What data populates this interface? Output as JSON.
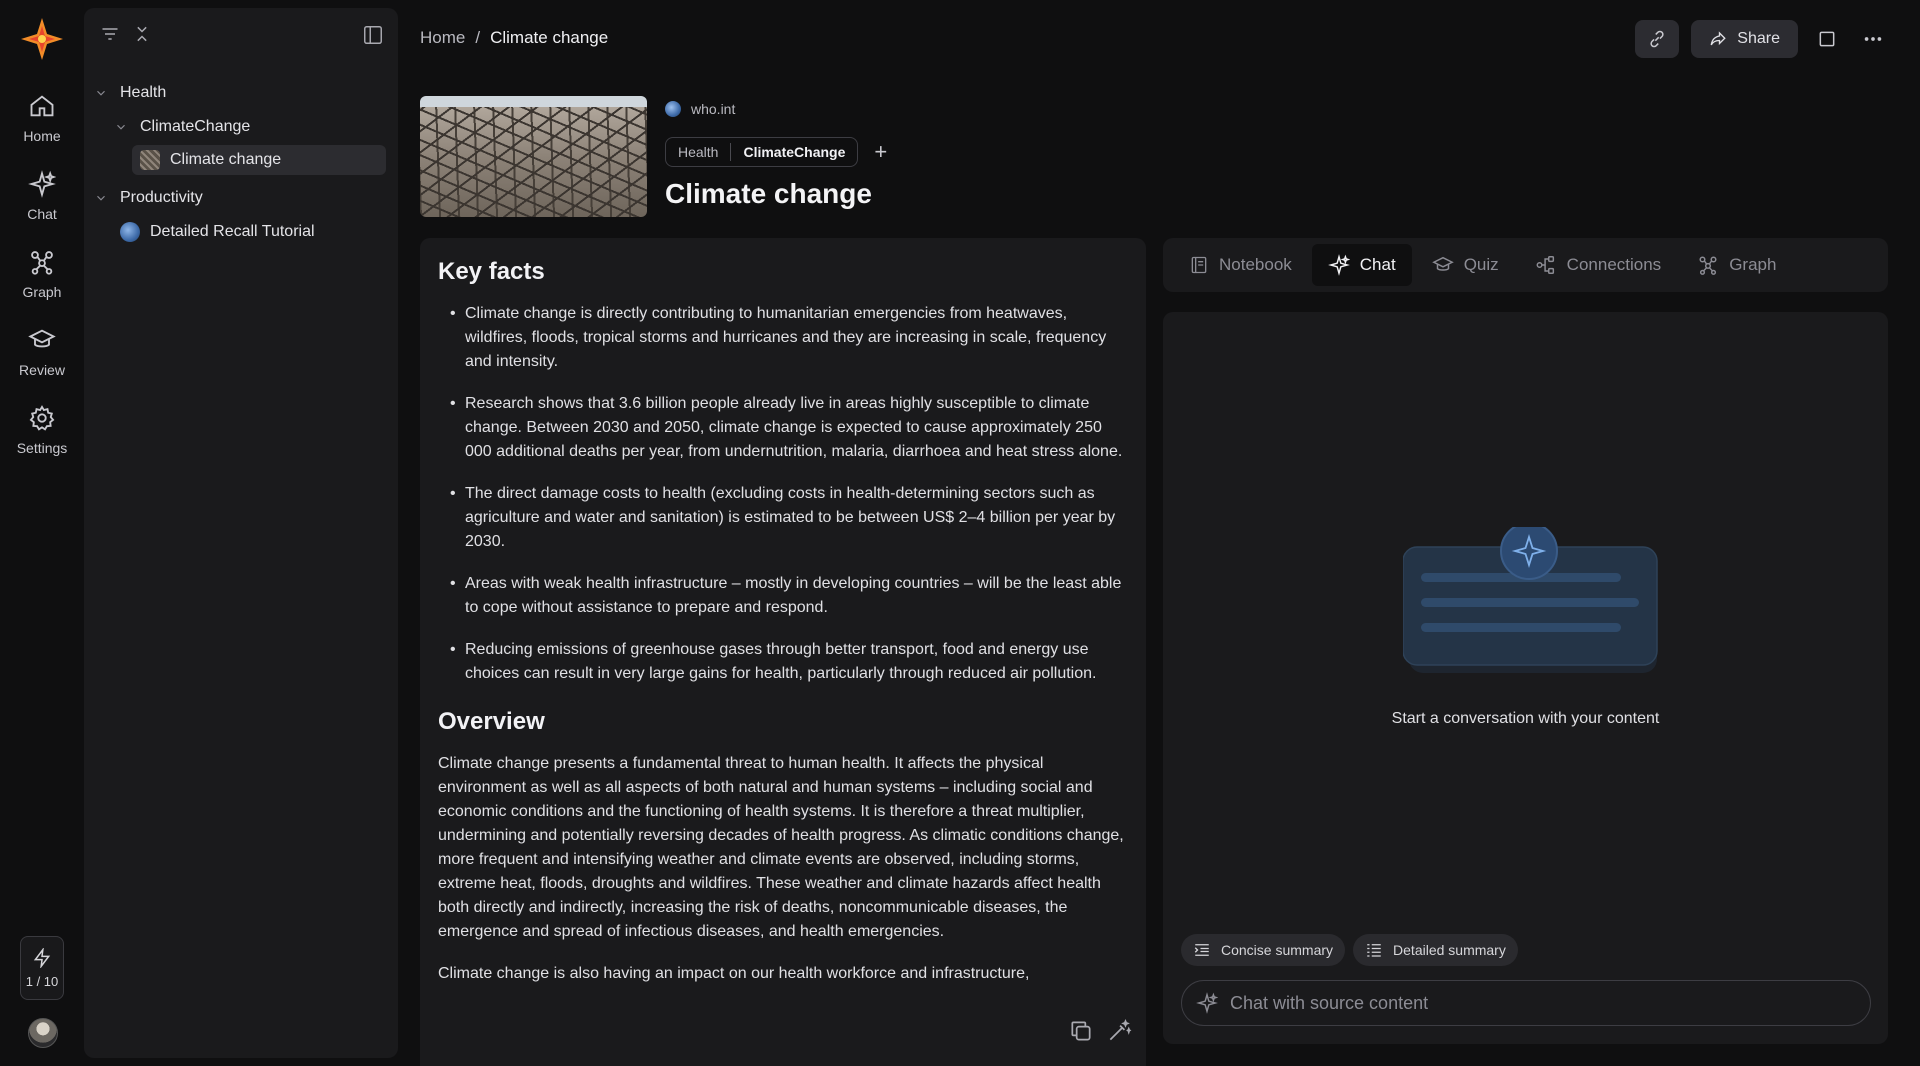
{
  "rail": {
    "items": [
      {
        "label": "Home",
        "icon": "home-icon"
      },
      {
        "label": "Chat",
        "icon": "sparkle-icon"
      },
      {
        "label": "Graph",
        "icon": "graph-icon"
      },
      {
        "label": "Review",
        "icon": "graduation-cap-icon"
      },
      {
        "label": "Settings",
        "icon": "gear-icon"
      }
    ],
    "credits": "1 / 10"
  },
  "sidebar": {
    "tree": [
      {
        "label": "Health",
        "level": 0,
        "expanded": true
      },
      {
        "label": "ClimateChange",
        "level": 1,
        "expanded": true
      },
      {
        "label": "Climate change",
        "level": 2,
        "selected": true
      },
      {
        "label": "Productivity",
        "level": 0,
        "expanded": true
      },
      {
        "label": "Detailed Recall Tutorial",
        "level": 1
      }
    ]
  },
  "breadcrumb": {
    "home": "Home",
    "separator": "/",
    "current": "Climate change"
  },
  "toolbar": {
    "share_label": "Share"
  },
  "card": {
    "source": "who.int",
    "tags": [
      "Health",
      "ClimateChange"
    ],
    "add_tag": "+",
    "title": "Climate change"
  },
  "article": {
    "key_facts_heading": "Key facts",
    "key_facts": [
      "Climate change is directly contributing to humanitarian emergencies from heatwaves, wildfires, floods, tropical storms and hurricanes and they are increasing in scale, frequency and intensity.",
      "Research shows that 3.6 billion people already live in areas highly susceptible to climate change. Between 2030 and 2050, climate change is expected to cause approximately 250 000 additional deaths per year, from undernutrition, malaria, diarrhoea and heat stress alone.",
      "The direct damage costs to health (excluding costs in health-determining sectors such as agriculture and water and sanitation) is estimated to be between US$ 2–4 billion per year by 2030.",
      "Areas with weak health infrastructure – mostly in developing countries – will be the least able to cope without assistance to prepare and respond.",
      "Reducing emissions of greenhouse gases through better transport, food and energy use choices can result in very large gains for health, particularly through reduced air pollution."
    ],
    "overview_heading": "Overview",
    "overview_p1": "Climate change presents a fundamental threat to human health. It affects the physical environment as well as all aspects of both natural and human systems – including social and economic conditions and the functioning of health systems. It is therefore a threat multiplier, undermining and potentially reversing decades of health progress. As climatic conditions change, more frequent and intensifying weather and climate events are observed, including storms, extreme heat, floods, droughts and wildfires. These weather and climate hazards affect health both directly and indirectly, increasing the risk of deaths, noncommunicable diseases, the emergence and spread of infectious diseases, and health emergencies.",
    "overview_p2": "Climate change is also having an impact on our health workforce and infrastructure,"
  },
  "panel": {
    "tabs": [
      {
        "label": "Notebook",
        "icon": "notebook-icon",
        "active": false
      },
      {
        "label": "Chat",
        "icon": "sparkle-icon",
        "active": true
      },
      {
        "label": "Quiz",
        "icon": "graduation-cap-icon",
        "active": false
      },
      {
        "label": "Connections",
        "icon": "connections-icon",
        "active": false
      },
      {
        "label": "Graph",
        "icon": "graph-icon",
        "active": false
      }
    ],
    "empty_text": "Start a conversation with your content",
    "chips": [
      {
        "label": "Concise summary",
        "icon": "list-indent-icon"
      },
      {
        "label": "Detailed summary",
        "icon": "list-icon"
      }
    ],
    "input_placeholder": "Chat with source content"
  },
  "colors": {
    "background": "#0f0f10",
    "panel": "#1a1a1c",
    "accent": "#2c4a72"
  }
}
